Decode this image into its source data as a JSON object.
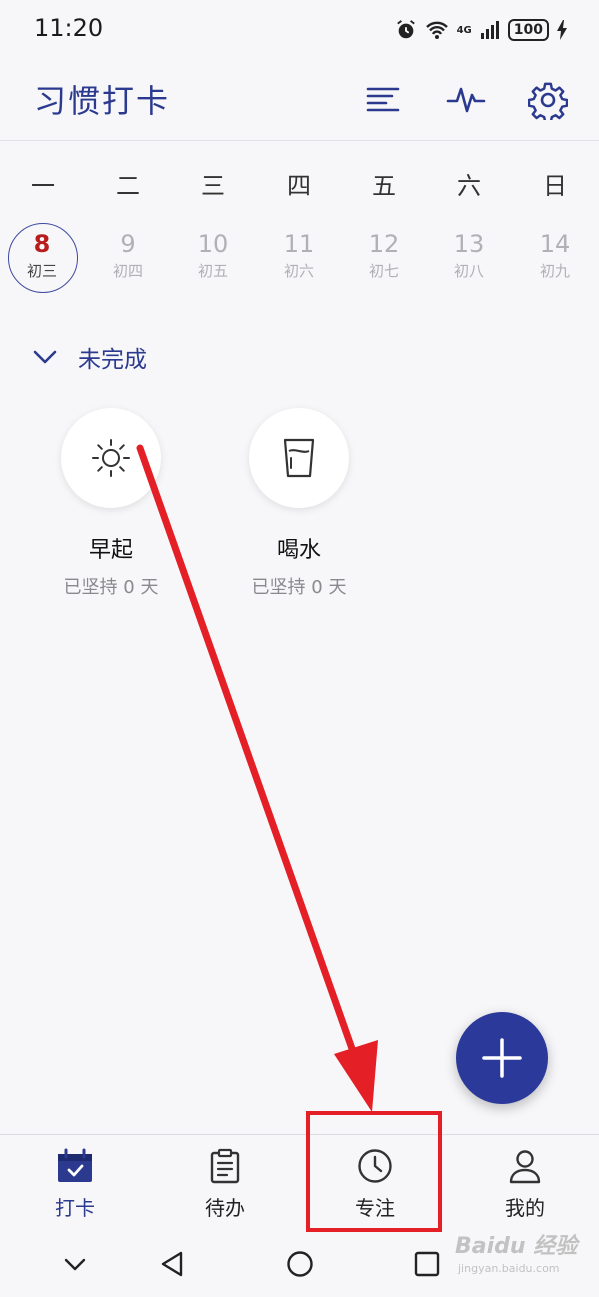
{
  "status_bar": {
    "time": "11:20",
    "battery": "100",
    "network": "4G"
  },
  "header": {
    "title": "习惯打卡"
  },
  "week": {
    "weekdays": [
      "一",
      "二",
      "三",
      "四",
      "五",
      "六",
      "日"
    ],
    "days": [
      {
        "num": "8",
        "lunar": "初三"
      },
      {
        "num": "9",
        "lunar": "初四"
      },
      {
        "num": "10",
        "lunar": "初五"
      },
      {
        "num": "11",
        "lunar": "初六"
      },
      {
        "num": "12",
        "lunar": "初七"
      },
      {
        "num": "13",
        "lunar": "初八"
      },
      {
        "num": "14",
        "lunar": "初九"
      }
    ]
  },
  "section": {
    "title": "未完成"
  },
  "habits": [
    {
      "name": "早起",
      "streak": "已坚持 0 天",
      "icon": "sun-icon"
    },
    {
      "name": "喝水",
      "streak": "已坚持 0 天",
      "icon": "water-glass-icon"
    }
  ],
  "bottom_nav": [
    {
      "label": "打卡",
      "icon": "calendar-check-icon",
      "active": true
    },
    {
      "label": "待办",
      "icon": "clipboard-icon",
      "active": false
    },
    {
      "label": "专注",
      "icon": "clock-icon",
      "active": false
    },
    {
      "label": "我的",
      "icon": "person-icon",
      "active": false
    }
  ],
  "colors": {
    "accent": "#2b3a8f",
    "today": "#b81d1d",
    "annotation": "#e41f25",
    "fab": "#2b3a9a"
  },
  "watermark": {
    "main": "Baidu 经验",
    "sub": "jingyan.baidu.com"
  }
}
